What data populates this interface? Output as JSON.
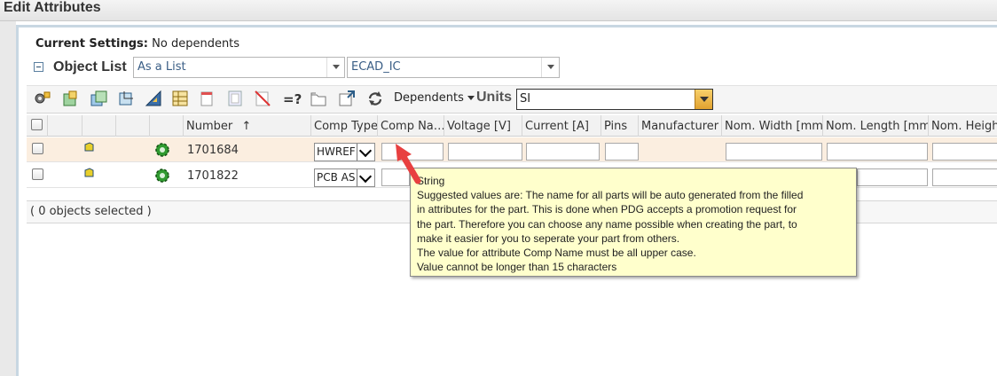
{
  "window": {
    "title": "Edit Attributes"
  },
  "current_settings": {
    "label": "Current Settings:",
    "value": "No dependents"
  },
  "object_list": {
    "label": "Object List",
    "view_select": "As a List",
    "type_select": "ECAD_IC"
  },
  "toolbar": {
    "dependents_label": "Dependents",
    "units_label": "Units",
    "units_value": "SI",
    "icons": [
      "configure-icon",
      "add-icon",
      "add-multiple-icon",
      "relate-icon",
      "triangle-ruler-icon",
      "table-icon",
      "delete-icon",
      "copy-icon",
      "clear-icon",
      "query-icon",
      "folder-icon",
      "export-icon",
      "refresh-icon"
    ]
  },
  "table": {
    "columns": [
      "Number",
      "Comp Type",
      "Comp Na…",
      "Voltage [V]",
      "Current [A]",
      "Pins",
      "Manufacturer",
      "Nom. Width [mm]",
      "Nom. Length [mm]",
      "Nom. Height"
    ],
    "sort_indicator": "↑",
    "rows": [
      {
        "number": "1701684",
        "comp_type": "HWREF"
      },
      {
        "number": "1701822",
        "comp_type": "PCB AS"
      }
    ],
    "footer": "( 0 objects selected )"
  },
  "tooltip": {
    "lines": [
      "String",
      "Suggested values are: The name for all parts will be auto generated from the filled",
      "in attributes for the part. This is done when PDG accepts a promotion request for",
      "the part. Therefore you can choose any name possible when creating the part, to",
      "make it easier for you to seperate your part from others.",
      "The value for attribute Comp Name must be all upper case.",
      "Value cannot be longer than 15 characters"
    ]
  },
  "colors": {
    "selected_row": "#fbeee0",
    "tooltip_bg": "#ffffcc",
    "arrow": "#e84040"
  }
}
